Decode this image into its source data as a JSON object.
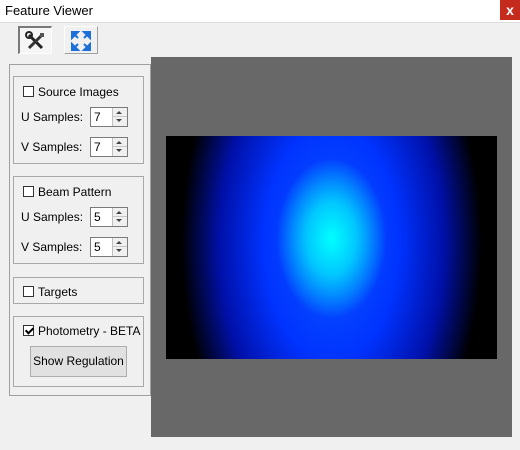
{
  "window": {
    "title": "Feature Viewer",
    "close_glyph": "x"
  },
  "toolbar": {
    "buttons": [
      {
        "name": "tools",
        "icon": "wrench-screwdriver-icon",
        "pressed": true
      },
      {
        "name": "fit",
        "icon": "expand-arrows-icon",
        "pressed": false
      }
    ]
  },
  "source_images": {
    "label": "Source Images",
    "checked": false,
    "u_label": "U Samples:",
    "u_value": "7",
    "v_label": "V Samples:",
    "v_value": "7"
  },
  "beam_pattern": {
    "label": "Beam Pattern",
    "checked": false,
    "u_label": "U Samples:",
    "u_value": "5",
    "v_label": "V Samples:",
    "v_value": "5"
  },
  "targets": {
    "label": "Targets",
    "checked": false
  },
  "photometry": {
    "label": "Photometry - BETA",
    "checked": true,
    "button_label": "Show Regulation"
  },
  "colors": {
    "viewer_background": "#686868",
    "beam_core": "#00ffff",
    "beam_outer": "#0033ff"
  }
}
